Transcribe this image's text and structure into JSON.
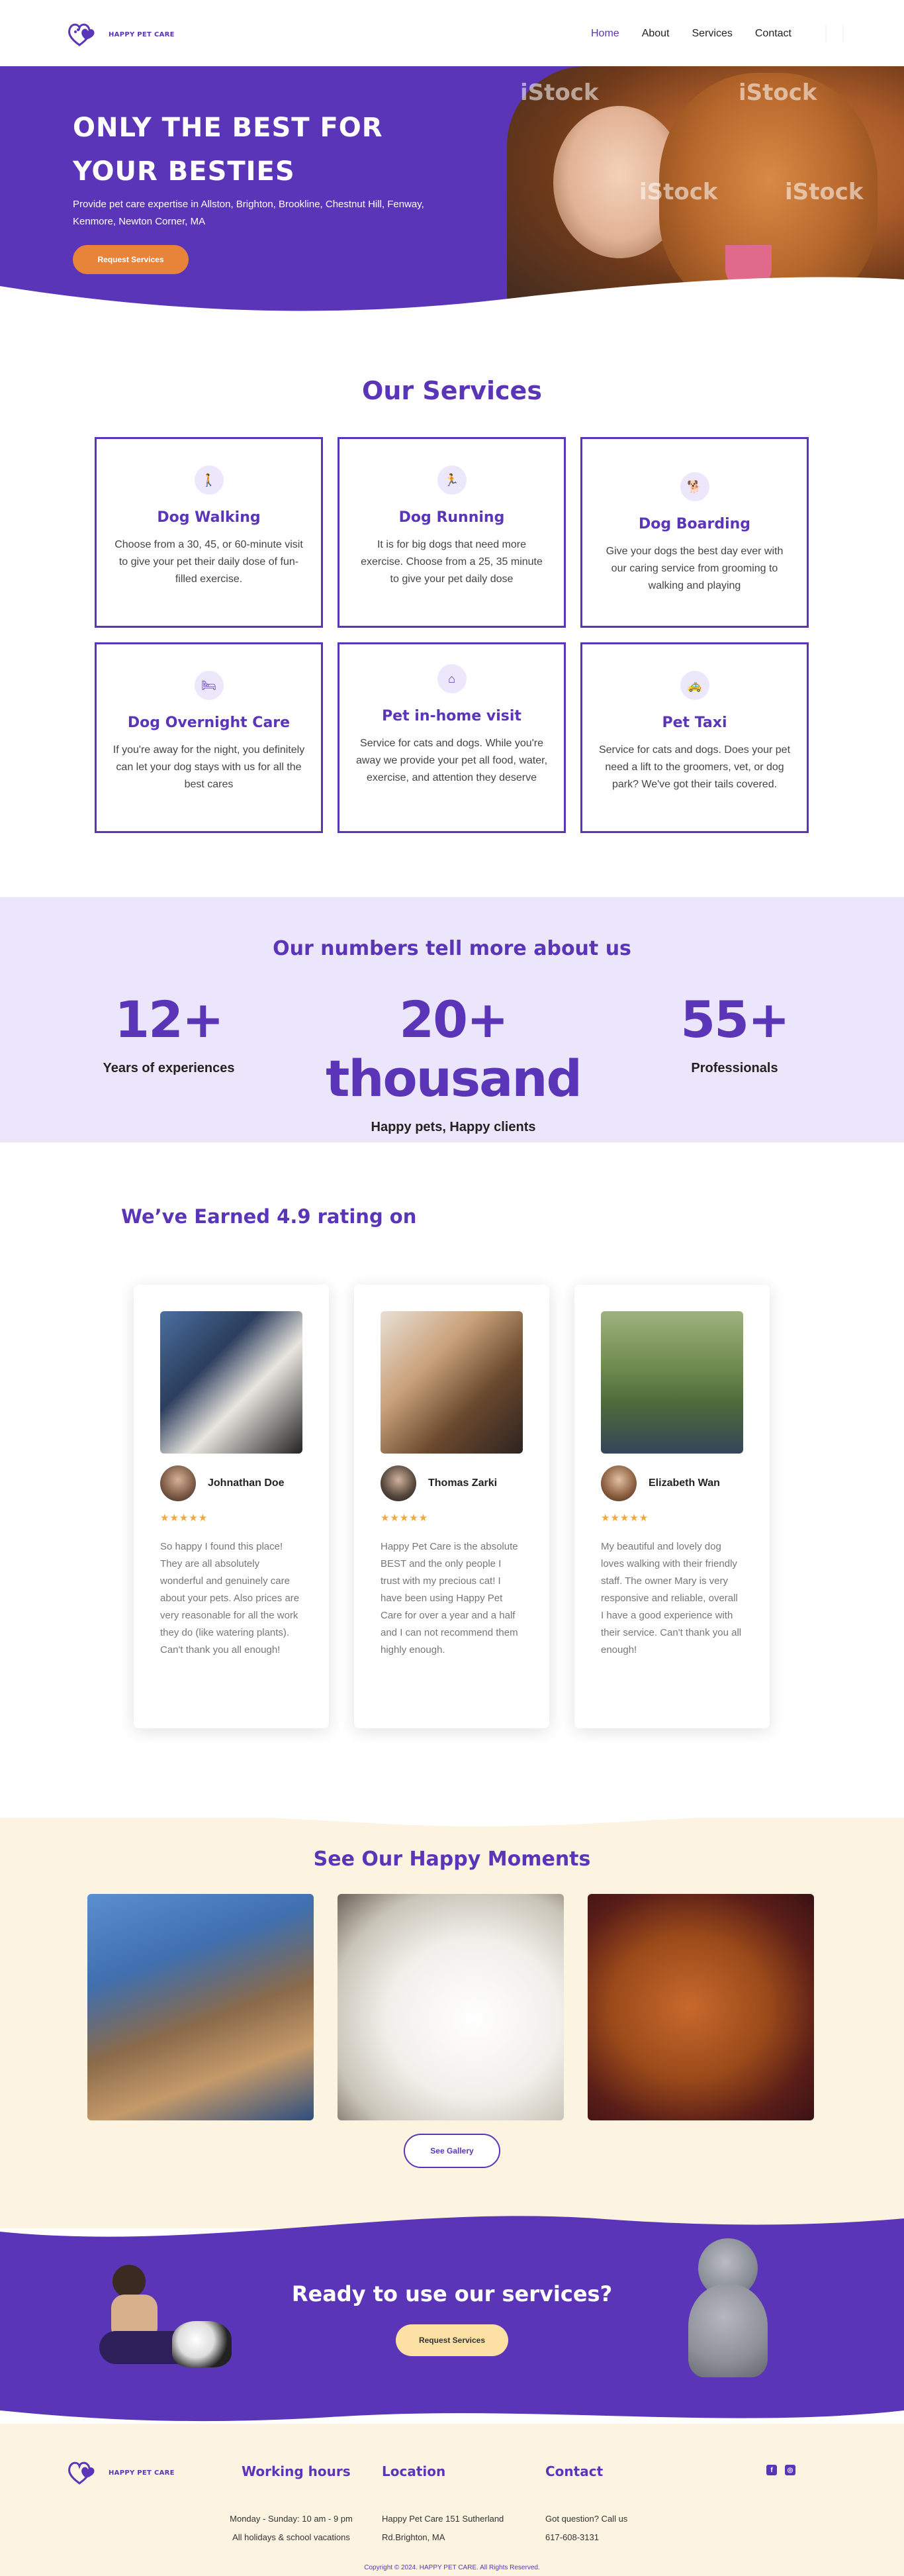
{
  "brand": {
    "name": "HAPPY PET CARE",
    "color": "#5b35b8",
    "accent": "#e8843a"
  },
  "nav": {
    "items": [
      "Home",
      "About",
      "Services",
      "Contact"
    ],
    "active": "Home"
  },
  "hero": {
    "title": "ONLY THE BEST FOR YOUR BESTIES",
    "subtitle": "Provide pet care expertise in Allston, Brighton, Brookline, Chestnut Hill, Fenway, Kenmore, Newton Corner, MA",
    "button": "Request Services",
    "watermark": "iStock"
  },
  "services": {
    "title": "Our Services",
    "items": [
      {
        "icon": "walking-person-icon",
        "title": "Dog Walking",
        "text": "Choose from a 30, 45, or 60-minute visit to give your pet their daily dose of fun-filled exercise."
      },
      {
        "icon": "running-person-icon",
        "title": "Dog Running",
        "text": "It is for big dogs that need more exercise. Choose from a 25, 35 minute to give your pet daily dose"
      },
      {
        "icon": "dog-icon",
        "title": "Dog Boarding",
        "text": "Give your dogs the best day ever with our caring service from grooming to walking and playing"
      },
      {
        "icon": "bed-icon",
        "title": "Dog Overnight Care",
        "text": "If you're away for the night, you definitely can let your dog stays with us for all the best cares"
      },
      {
        "icon": "house-heart-icon",
        "title": "Pet in-home visit",
        "text": "Service for cats and dogs. While you're away we provide your pet all food, water, exercise, and attention they deserve"
      },
      {
        "icon": "car-icon",
        "title": "Pet Taxi",
        "text": "Service for cats and dogs. Does your pet need a lift to the groomers, vet, or dog park? We've got their tails covered."
      }
    ]
  },
  "numbers": {
    "title": "Our numbers tell more about us",
    "items": [
      {
        "value": "12+",
        "label": "Years of experiences"
      },
      {
        "value": "20+ thousand",
        "label": "Happy pets, Happy clients"
      },
      {
        "value": "55+",
        "label": "Professionals"
      }
    ]
  },
  "rating": {
    "title": "We’ve Earned 4.9 rating on",
    "reviews": [
      {
        "name": "Johnathan Doe",
        "stars": "★★★★★",
        "text": "So happy I found this place! They are all absolutely wonderful and genuinely care about your pets. Also prices are very reasonable for all the work they do (like watering plants). Can't thank you all enough!"
      },
      {
        "name": "Thomas Zarki",
        "stars": "★★★★★",
        "text": "Happy Pet Care is the absolute BEST and the only people I trust with my precious cat! I have been using Happy Pet Care for over a year and a half and I can not recommend them highly enough."
      },
      {
        "name": "Elizabeth Wan",
        "stars": "★★★★★",
        "text": "My beautiful and lovely dog loves walking with their friendly staff. The owner Mary is very responsive and reliable, overall I have a good experience with their service. Can't thank you all enough!"
      }
    ]
  },
  "moments": {
    "title": "See Our Happy Moments",
    "button": "See Gallery"
  },
  "cta": {
    "title": "Ready to use our services?",
    "button": "Request Services"
  },
  "footer": {
    "hours_title": "Working hours",
    "hours": [
      "Monday - Sunday: 10 am - 9 pm",
      "All holidays & school vacations"
    ],
    "location_title": "Location",
    "location": [
      "Happy Pet Care 151 Sutherland",
      "Rd.Brighton, MA"
    ],
    "contact_title": "Contact",
    "contact": [
      "Got question? Call us",
      "617-608-3131"
    ],
    "copyright": "Copyright © 2024. HAPPY PET CARE. All Rights Reserved."
  }
}
